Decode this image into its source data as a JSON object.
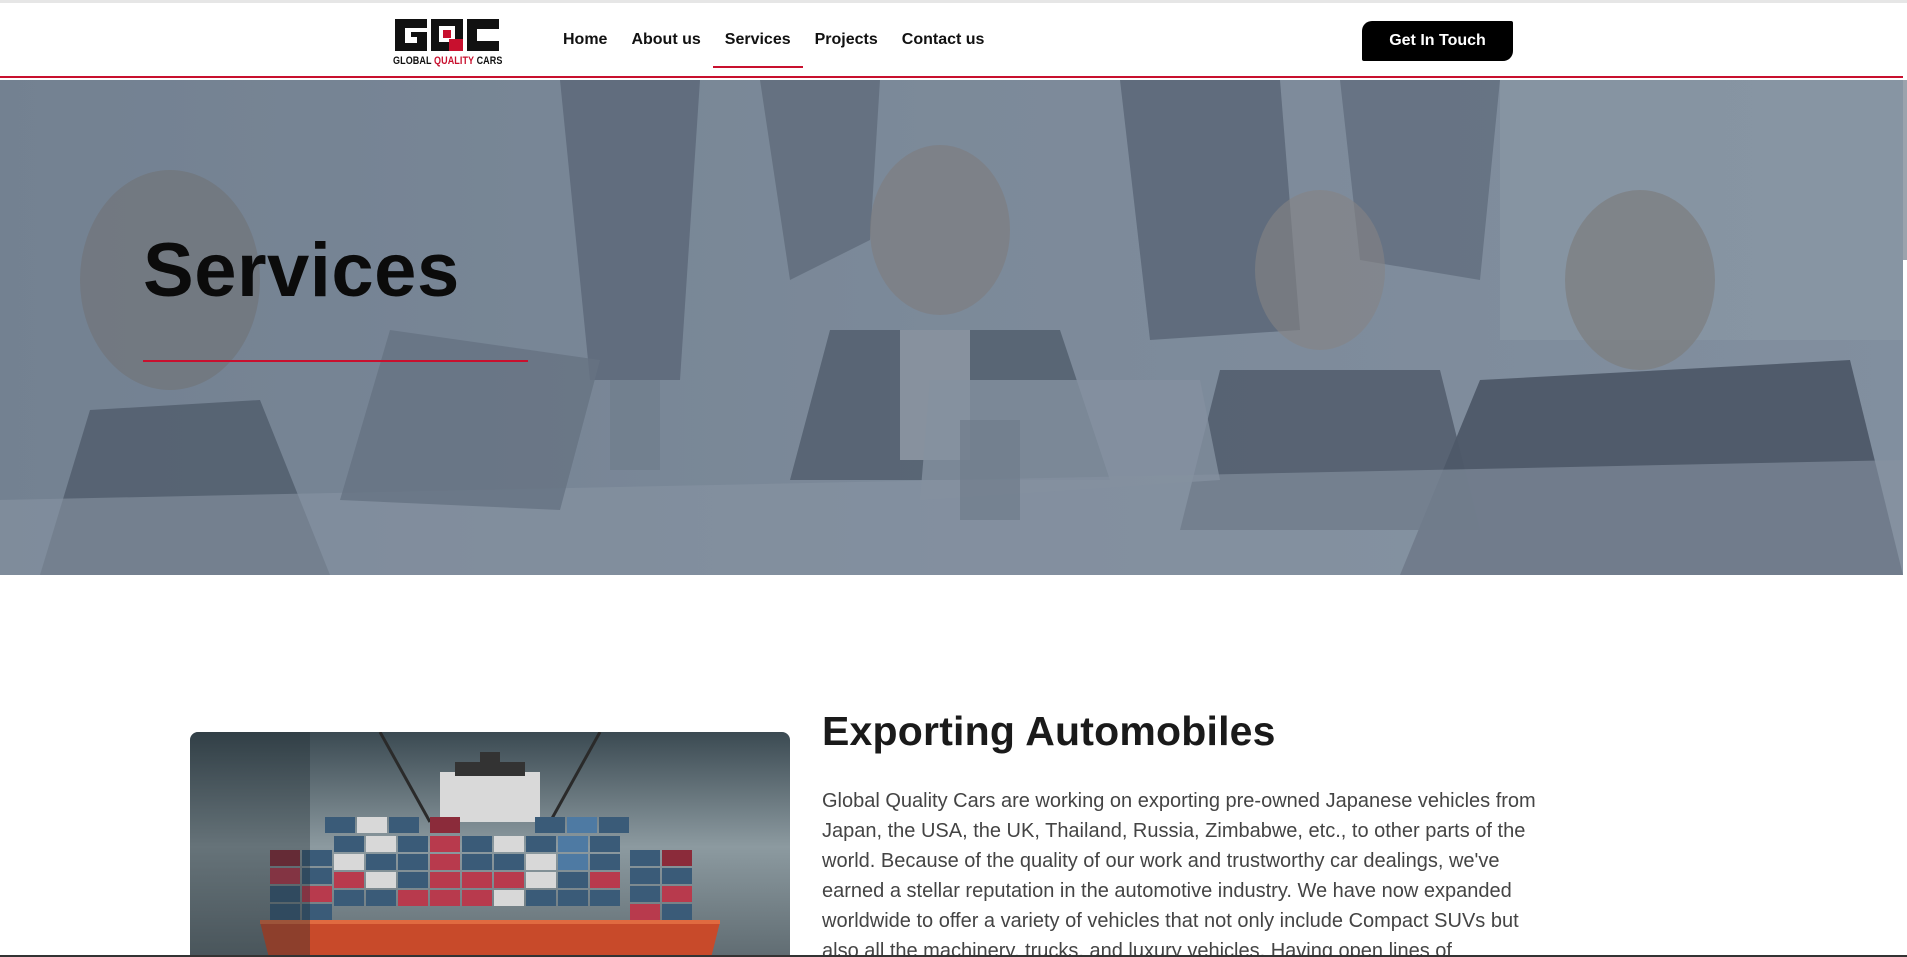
{
  "brand": {
    "logo_mark": "GQC",
    "logo_caption_left": "GLOBAL ",
    "logo_caption_red": "QUALITY",
    "logo_caption_right": " CARS",
    "accent_color": "#c8102e"
  },
  "nav": {
    "items": [
      {
        "label": "Home"
      },
      {
        "label": "About us"
      },
      {
        "label": "Services",
        "active": true
      },
      {
        "label": "Projects"
      },
      {
        "label": "Contact us"
      }
    ],
    "cta_label": "Get In Touch"
  },
  "hero": {
    "title": "Services"
  },
  "section": {
    "title": "Exporting Automobiles",
    "body_lines": [
      "Global Quality Cars are working on exporting pre-owned Japanese vehicles from",
      "Japan, the USA, the UK, Thailand, Russia, Zimbabwe, etc., to other parts of the",
      "world. Because of the quality of our work and trustworthy car dealings, we've",
      "earned a stellar reputation in the automotive industry. We have now expanded",
      "worldwide to offer a variety of vehicles that not only include Compact SUVs but",
      "also all the machinery, trucks, and luxury vehicles. Having open lines of"
    ]
  }
}
